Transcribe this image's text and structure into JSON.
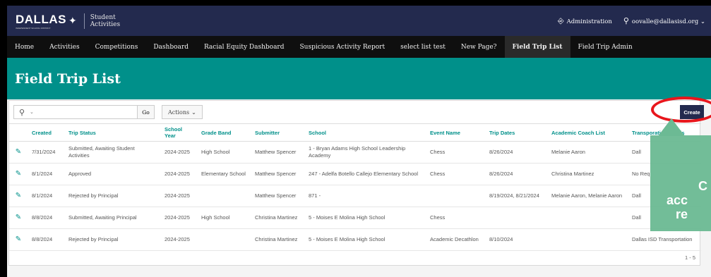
{
  "header": {
    "logo_text": "DALLAS",
    "logo_subtext": "INDEPENDENT SCHOOL DISTRICT",
    "product_line1": "Student",
    "product_line2": "Activities",
    "admin_label": "Administration",
    "user_label": "oovalle@dallasisd.org"
  },
  "nav": [
    {
      "label": "Home",
      "bold": false
    },
    {
      "label": "Activities",
      "bold": false
    },
    {
      "label": "Competitions",
      "bold": false
    },
    {
      "label": "Dashboard",
      "bold": false
    },
    {
      "label": "Racial Equity Dashboard",
      "bold": false
    },
    {
      "label": "Suspicious Activity Report",
      "bold": false
    },
    {
      "label": "select list test",
      "bold": false
    },
    {
      "label": "New Page?",
      "bold": false
    },
    {
      "label": "Field Trip List",
      "bold": true
    },
    {
      "label": "Field Trip Admin",
      "bold": false
    }
  ],
  "page": {
    "title": "Field Trip List"
  },
  "toolbar": {
    "go_label": "Go",
    "actions_label": "Actions",
    "create_label": "Create"
  },
  "table": {
    "columns": [
      "",
      "Created",
      "Trip Status",
      "School Year",
      "Grade Band",
      "Submitter",
      "School",
      "Event Name",
      "Trip Dates",
      "Academic Coach List",
      "Transporation Needs"
    ],
    "rows": [
      [
        "",
        "7/31/2024",
        "Submitted, Awaiting Student Activities",
        "2024-2025",
        "High School",
        "Matthew Spencer",
        "1 - Bryan Adams High School Leadership Academy",
        "Chess",
        "8/26/2024",
        "Melanie Aaron",
        "Dall"
      ],
      [
        "",
        "8/1/2024",
        "Approved",
        "2024-2025",
        "Elementary School",
        "Matthew Spencer",
        "247 - Adelfa Botello Callejo Elementary School",
        "Chess",
        "8/26/2024",
        "Christina Martinez",
        "No Req"
      ],
      [
        "",
        "8/1/2024",
        "Rejected by Principal",
        "2024-2025",
        "",
        "Matthew Spencer",
        "871 -",
        "",
        "8/19/2024, 8/21/2024",
        "Melanie Aaron, Melanie Aaron",
        "Dall"
      ],
      [
        "",
        "8/8/2024",
        "Submitted, Awaiting Principal",
        "2024-2025",
        "High School",
        "Christina Martinez",
        "5 - Moises E Molina High School",
        "Chess",
        "",
        "",
        "Dall"
      ],
      [
        "",
        "8/8/2024",
        "Rejected by Principal",
        "2024-2025",
        "",
        "Christina Martinez",
        "5 - Moises E Molina High School",
        "Academic Decathlon",
        "8/10/2024",
        "",
        "Dallas ISD Transportation"
      ]
    ]
  },
  "pager": {
    "label": "1 - 5"
  },
  "annotation": {
    "line1": "C",
    "line2": "acc",
    "line3": "re"
  },
  "colors": {
    "brand_navy": "#232a4e",
    "brand_teal": "#00908a",
    "annot_red": "#e8161c",
    "annot_green": "#6cba94"
  }
}
